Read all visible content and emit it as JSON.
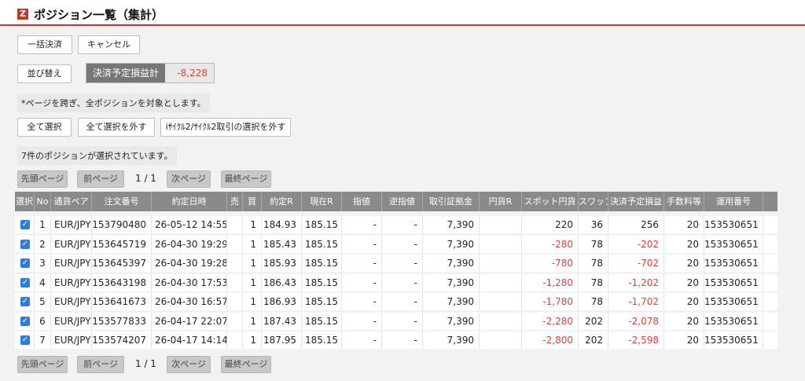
{
  "header": {
    "logo": "Z",
    "title": "ポジション一覧（集計）"
  },
  "buttons": {
    "bulk_settle": "一括決済",
    "cancel": "キャンセル",
    "sort": "並び替え",
    "select_all": "全て選択",
    "deselect_all": "全て選択を外す",
    "deselect_icycle": "iｻｲｸﾙ2/ｻｲｸﾙ2取引の選択を外す"
  },
  "summary": {
    "label": "決済予定損益計",
    "value": "-8,228"
  },
  "notes": {
    "cross_page": "*ページを跨ぎ、全ポジションを対象とします。",
    "selected_count": "7件のポジションが選択されています。"
  },
  "pager": {
    "first": "先頭ページ",
    "prev": "前ページ",
    "info": "1 / 1",
    "next": "次ページ",
    "last": "最終ページ"
  },
  "table": {
    "headers": [
      "選択",
      "No",
      "通貨ペア",
      "注文番号",
      "約定日時",
      "売",
      "買",
      "約定R",
      "現在R",
      "指値",
      "逆指値",
      "取引証拠金",
      "円貨R",
      "スポット円貨",
      "スワップ",
      "決済予定損益",
      "手数料等",
      "運用番号"
    ],
    "rows": [
      [
        "✓",
        "1",
        "EUR/JPY",
        "153790480",
        "26-05-12 14:55",
        "",
        "1",
        "184.93",
        "185.15",
        "-",
        "-",
        "7,390",
        "",
        "220",
        "36",
        "256",
        "20",
        "153530651"
      ],
      [
        "✓",
        "2",
        "EUR/JPY",
        "153645719",
        "26-04-30 19:29",
        "",
        "1",
        "185.43",
        "185.15",
        "-",
        "-",
        "7,390",
        "",
        "-280",
        "78",
        "-202",
        "20",
        "153530651"
      ],
      [
        "✓",
        "3",
        "EUR/JPY",
        "153645397",
        "26-04-30 19:28",
        "",
        "1",
        "185.93",
        "185.15",
        "-",
        "-",
        "7,390",
        "",
        "-780",
        "78",
        "-702",
        "20",
        "153530651"
      ],
      [
        "✓",
        "4",
        "EUR/JPY",
        "153643198",
        "26-04-30 17:53",
        "",
        "1",
        "186.43",
        "185.15",
        "-",
        "-",
        "7,390",
        "",
        "-1,280",
        "78",
        "-1,202",
        "20",
        "153530651"
      ],
      [
        "✓",
        "5",
        "EUR/JPY",
        "153641673",
        "26-04-30 16:57",
        "",
        "1",
        "186.93",
        "185.15",
        "-",
        "-",
        "7,390",
        "",
        "-1,780",
        "78",
        "-1,702",
        "20",
        "153530651"
      ],
      [
        "✓",
        "6",
        "EUR/JPY",
        "153577833",
        "26-04-17 22:07",
        "",
        "1",
        "187.43",
        "185.15",
        "-",
        "-",
        "7,390",
        "",
        "-2,280",
        "202",
        "-2,078",
        "20",
        "153530651"
      ],
      [
        "✓",
        "7",
        "EUR/JPY",
        "153574207",
        "26-04-17 14:14",
        "",
        "1",
        "187.95",
        "185.15",
        "-",
        "-",
        "7,390",
        "",
        "-2,800",
        "202",
        "-2,598",
        "20",
        "153530651"
      ]
    ]
  },
  "colors": {
    "accent": "#b83a2e",
    "negative": "#e0413a",
    "header_bg": "#8a8a8a",
    "checkbox": "#2f7be0"
  }
}
